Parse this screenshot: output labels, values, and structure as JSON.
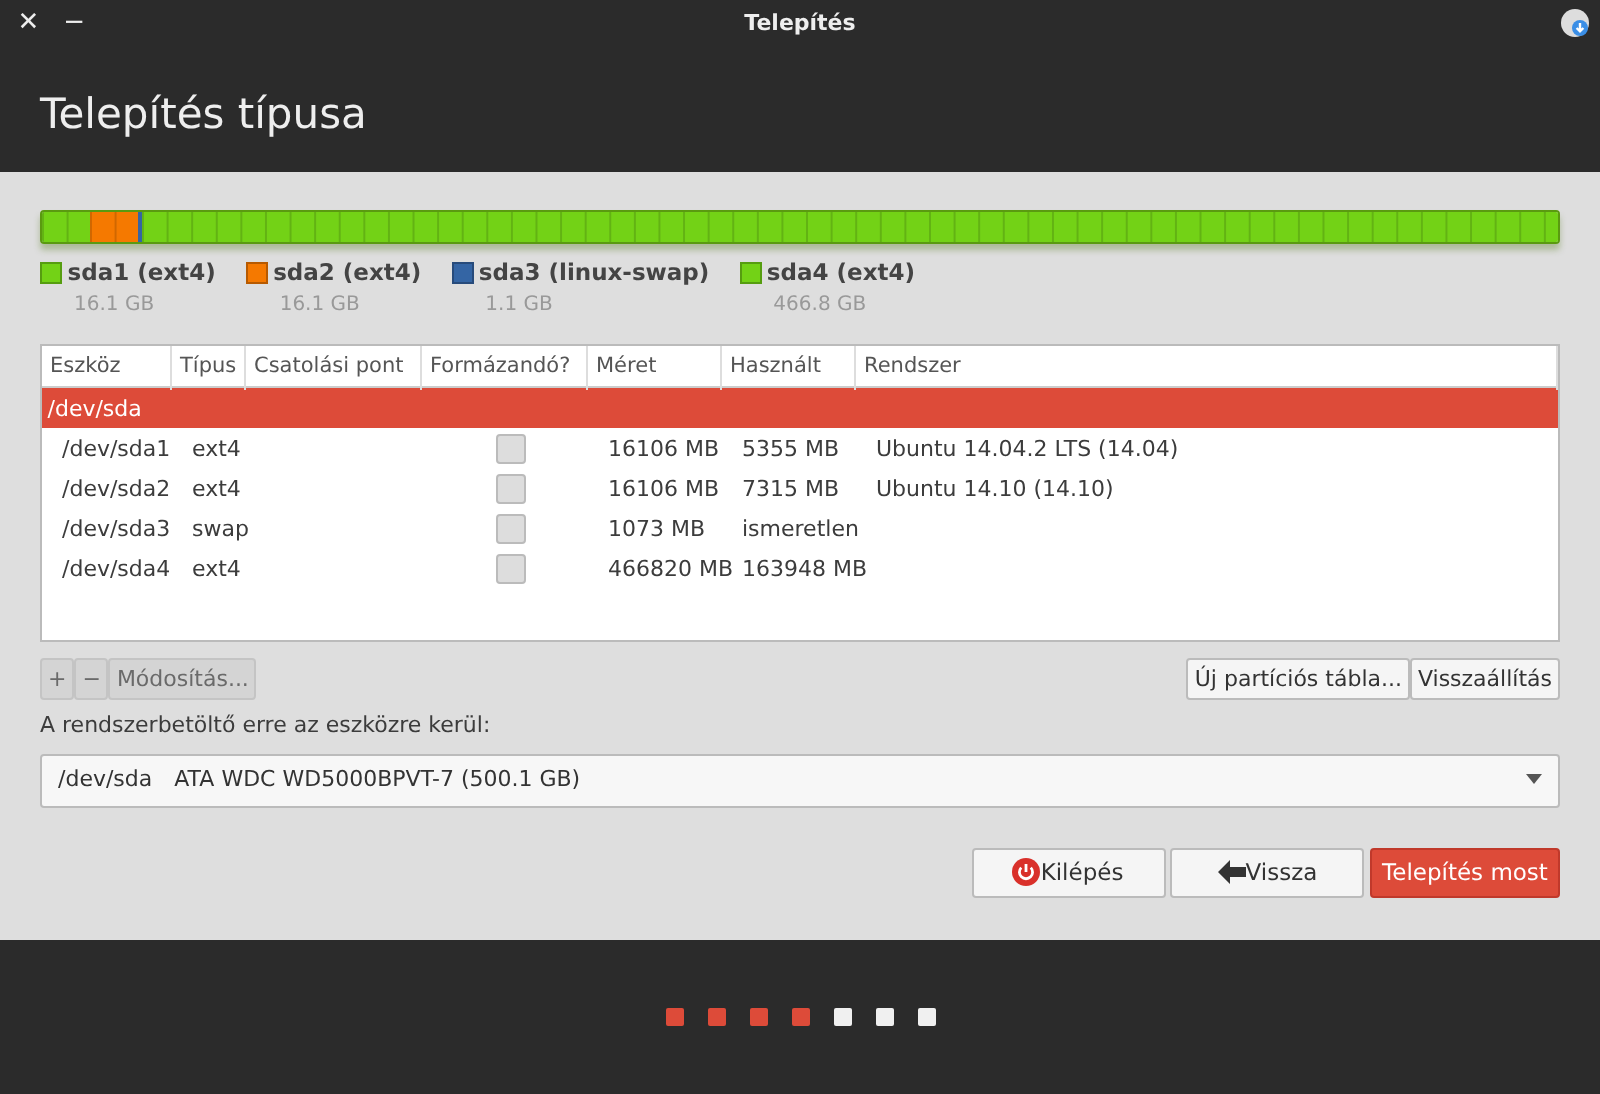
{
  "window": {
    "title": "Telepítés",
    "close": "✕",
    "minimize": "−"
  },
  "header": {
    "title": "Telepítés típusa"
  },
  "partition_bar": [
    {
      "color": "#73d216",
      "level": 0.032
    },
    {
      "color": "#f57900",
      "level": 0.032
    },
    {
      "color": "#3465a4",
      "level": 0.0022
    },
    {
      "color": "#73d216",
      "level": 0.9338
    }
  ],
  "legend": [
    {
      "name": "sda1 (ext4)",
      "size": "16.1 GB",
      "color": "#73d216"
    },
    {
      "name": "sda2 (ext4)",
      "size": "16.1 GB",
      "color": "#f57900"
    },
    {
      "name": "sda3 (linux-swap)",
      "size": "1.1 GB",
      "color": "#3465a4"
    },
    {
      "name": "sda4 (ext4)",
      "size": "466.8 GB",
      "color": "#73d216"
    }
  ],
  "table": {
    "columns": [
      "Eszköz",
      "Típus",
      "Csatolási pont",
      "Formázandó?",
      "Méret",
      "Használt",
      "Rendszer"
    ],
    "rows": [
      {
        "kind": "disk",
        "selected": true,
        "cells": [
          "/dev/sda"
        ]
      },
      {
        "kind": "partition",
        "selected": false,
        "cells": [
          "/dev/sda1",
          "ext4",
          "",
          "",
          "16106 MB",
          "5355 MB",
          "Ubuntu 14.04.2 LTS (14.04)"
        ],
        "format": false
      },
      {
        "kind": "partition",
        "selected": false,
        "cells": [
          "/dev/sda2",
          "ext4",
          "",
          "",
          "16106 MB",
          "7315 MB",
          "Ubuntu 14.10 (14.10)"
        ],
        "format": false
      },
      {
        "kind": "partition",
        "selected": false,
        "cells": [
          "/dev/sda3",
          "swap",
          "",
          "",
          "1073 MB",
          "ismeretlen",
          ""
        ],
        "format": false
      },
      {
        "kind": "partition",
        "selected": false,
        "cells": [
          "/dev/sda4",
          "ext4",
          "",
          "",
          "466820 MB",
          "163948 MB",
          ""
        ],
        "format": false
      }
    ]
  },
  "toolbar": {
    "add": {
      "label": "+",
      "disabled": true
    },
    "remove": {
      "label": "−",
      "disabled": true
    },
    "change": {
      "label": "Módosítás...",
      "disabled": true
    },
    "new_table": "Új partíciós tábla...",
    "revert": "Visszaállítás"
  },
  "bootloader": {
    "label": "A rendszerbetöltő erre az eszközre kerül:",
    "device": "/dev/sda",
    "description": "ATA WDC WD5000BPVT-7 (500.1 GB)"
  },
  "buttons": [
    {
      "kind": "quit",
      "label": "Kilépés"
    },
    {
      "kind": "back",
      "label": "Vissza"
    },
    {
      "kind": "primary",
      "label": "Telepítés most"
    }
  ],
  "steps": [
    {
      "done": true
    },
    {
      "done": true
    },
    {
      "done": true
    },
    {
      "done": true
    },
    {
      "done": false
    },
    {
      "done": false
    },
    {
      "done": false
    }
  ]
}
